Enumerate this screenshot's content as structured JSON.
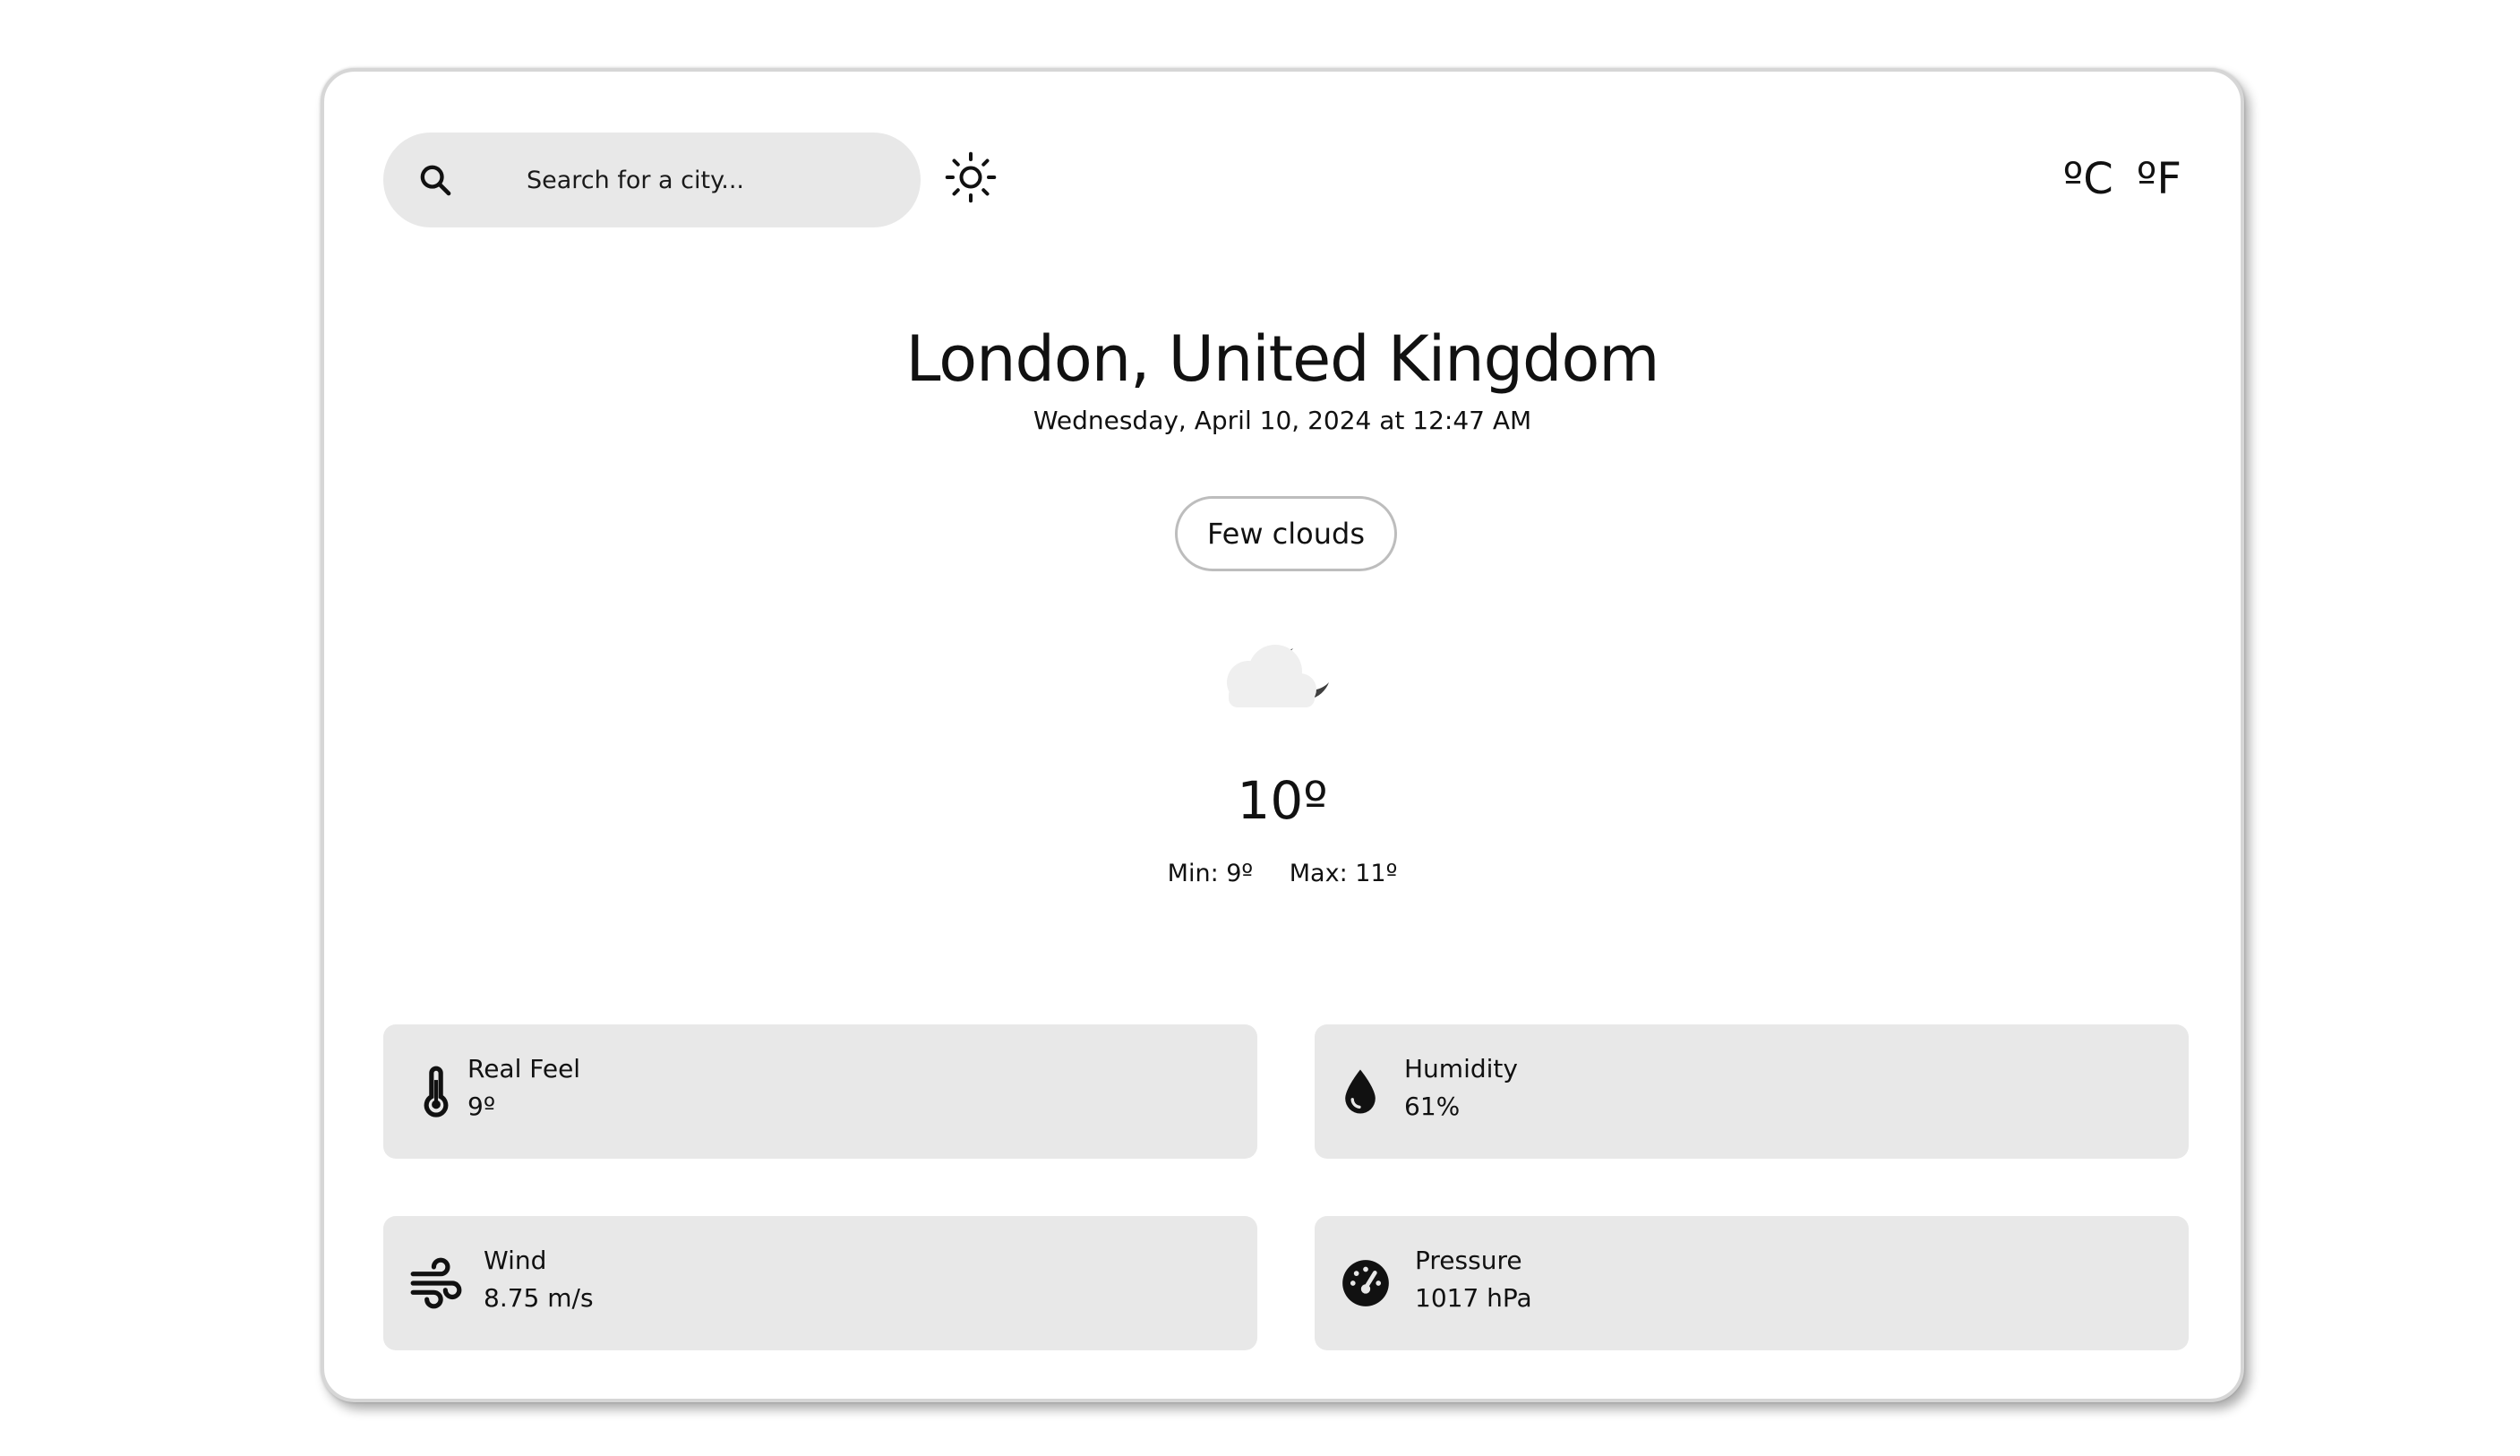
{
  "search": {
    "placeholder": "Search for a city..."
  },
  "units": {
    "celsius": "ºC",
    "fahrenheit": "ºF"
  },
  "location": {
    "city": "London, United Kingdom",
    "datetime": "Wednesday, April 10, 2024 at 12:47 AM"
  },
  "current": {
    "condition": "Few clouds",
    "icon": "cloud-moon-icon",
    "temperature": "10º",
    "min": "Min: 9º",
    "max": "Max: 11º"
  },
  "stats": {
    "real_feel": {
      "label": "Real Feel",
      "value": "9º",
      "icon": "thermometer-icon"
    },
    "humidity": {
      "label": "Humidity",
      "value": "61%",
      "icon": "water-drop-icon"
    },
    "wind": {
      "label": "Wind",
      "value": "8.75 m/s",
      "icon": "wind-icon"
    },
    "pressure": {
      "label": "Pressure",
      "value": "1017 hPa",
      "icon": "gauge-icon"
    }
  },
  "colors": {
    "panel": "#e8e8e8",
    "text": "#111111",
    "border": "#bdbdbd",
    "moon": "#3f3f3f",
    "cloud": "#efefef"
  }
}
